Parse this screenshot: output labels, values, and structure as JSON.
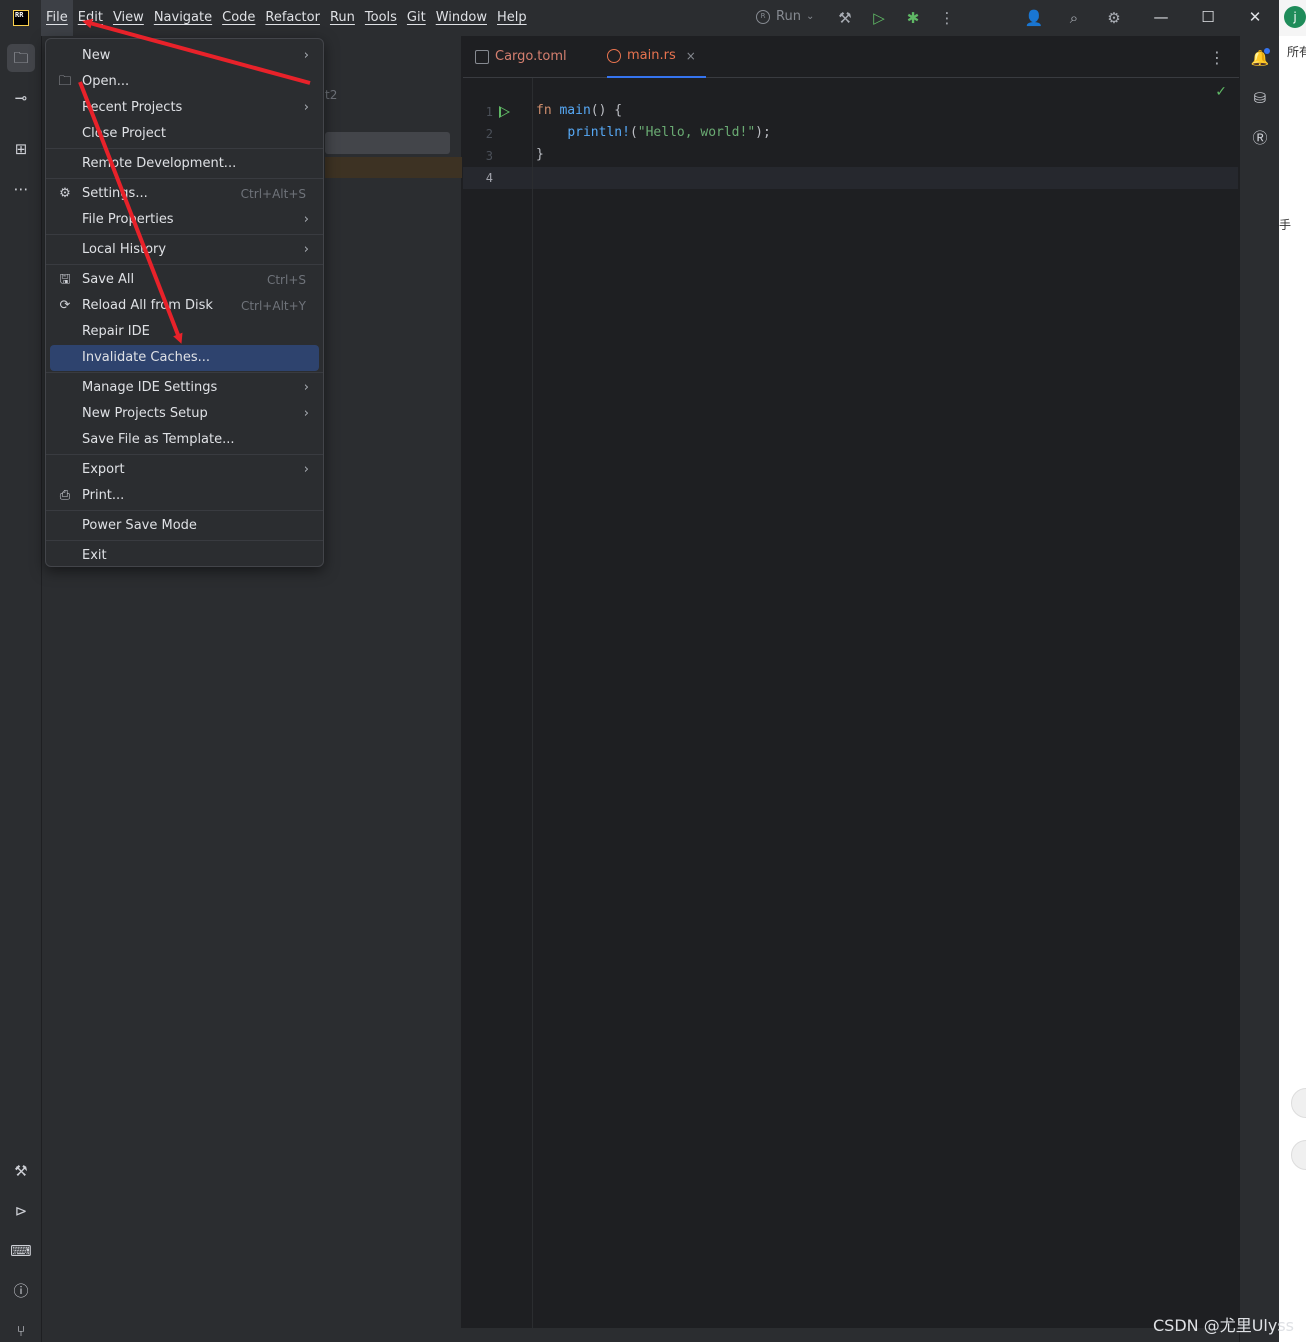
{
  "menubar": {
    "items": [
      "File",
      "Edit",
      "View",
      "Navigate",
      "Code",
      "Refactor",
      "Run",
      "Tools",
      "Git",
      "Window",
      "Help"
    ],
    "active": "File"
  },
  "toolbar": {
    "run_config_label": "Run",
    "icons": [
      "build-icon",
      "run-icon",
      "debug-icon",
      "more-icon",
      "code-with-me-icon",
      "search-icon",
      "settings-icon"
    ]
  },
  "file_menu": {
    "items": [
      {
        "label": "New",
        "submenu": true
      },
      {
        "label": "Open...",
        "icon": "folder-icon"
      },
      {
        "label": "Recent Projects",
        "submenu": true
      },
      {
        "label": "Close Project"
      },
      {
        "label": "Remote Development..."
      },
      {
        "label": "Settings...",
        "shortcut": "Ctrl+Alt+S",
        "icon": "gear-icon"
      },
      {
        "label": "File Properties",
        "submenu": true
      },
      {
        "label": "Local History",
        "submenu": true
      },
      {
        "label": "Save All",
        "shortcut": "Ctrl+S",
        "icon": "save-icon"
      },
      {
        "label": "Reload All from Disk",
        "shortcut": "Ctrl+Alt+Y",
        "icon": "reload-icon"
      },
      {
        "label": "Repair IDE"
      },
      {
        "label": "Invalidate Caches...",
        "selected": true
      },
      {
        "label": "Manage IDE Settings",
        "submenu": true
      },
      {
        "label": "New Projects Setup",
        "submenu": true
      },
      {
        "label": "Save File as Template..."
      },
      {
        "label": "Export",
        "submenu": true
      },
      {
        "label": "Print...",
        "icon": "print-icon"
      },
      {
        "label": "Power Save Mode"
      },
      {
        "label": "Exit"
      }
    ]
  },
  "project_pane": {
    "partial_text": "t2"
  },
  "editor": {
    "tabs": [
      {
        "label": "Cargo.toml",
        "icon": "toml-file-icon"
      },
      {
        "label": "main.rs",
        "icon": "rust-file-icon",
        "active": true,
        "close": "×"
      }
    ],
    "line_numbers": [
      "1",
      "2",
      "3",
      "4"
    ],
    "code": {
      "l1_kw": "fn",
      "l1_fn": "main",
      "l1_rest": "() {",
      "l2_indent": "    ",
      "l2_macro": "println!",
      "l2_open": "(",
      "l2_str": "\"Hello, world!\"",
      "l2_close": ");",
      "l3": "}"
    }
  },
  "external": {
    "avatar_letter": "j",
    "text_top": "所有",
    "text_mid": "手"
  },
  "watermark": "CSDN @尤里Ulyss",
  "colors": {
    "annotation_arrow": "#e8222a",
    "selection": "#2e436e",
    "accent": "#3574f0"
  }
}
